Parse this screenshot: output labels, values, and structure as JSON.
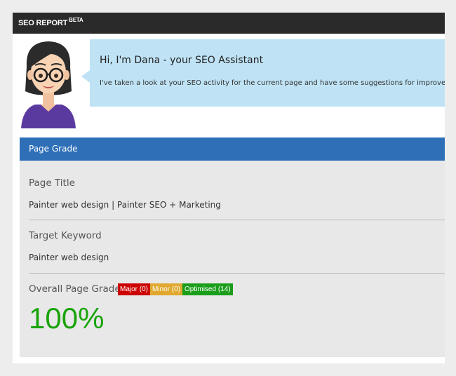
{
  "header": {
    "title": "SEO REPORT",
    "beta_label": "BETA"
  },
  "assistant": {
    "avatar_icon": "female-assistant-avatar-icon",
    "greeting": "Hi, I'm Dana - your SEO Assistant",
    "message": "I've taken a look at your SEO activity for the current page and have some suggestions for improveme"
  },
  "page_grade": {
    "section_title": "Page Grade",
    "page_title_label": "Page Title",
    "page_title_value": "Painter web design | Painter SEO + Marketing",
    "target_keyword_label": "Target Keyword",
    "target_keyword_value": "Painter web design",
    "overall_label": "Overall Page Grade",
    "badges": [
      {
        "label": "Major (0)",
        "color": "#cc0000"
      },
      {
        "label": "Minor (0)",
        "color": "#e0a82e"
      },
      {
        "label": "Optimised (14)",
        "color": "#1a9e1a"
      }
    ],
    "grade_value": "100%",
    "grade_color": "#1aa30a"
  }
}
